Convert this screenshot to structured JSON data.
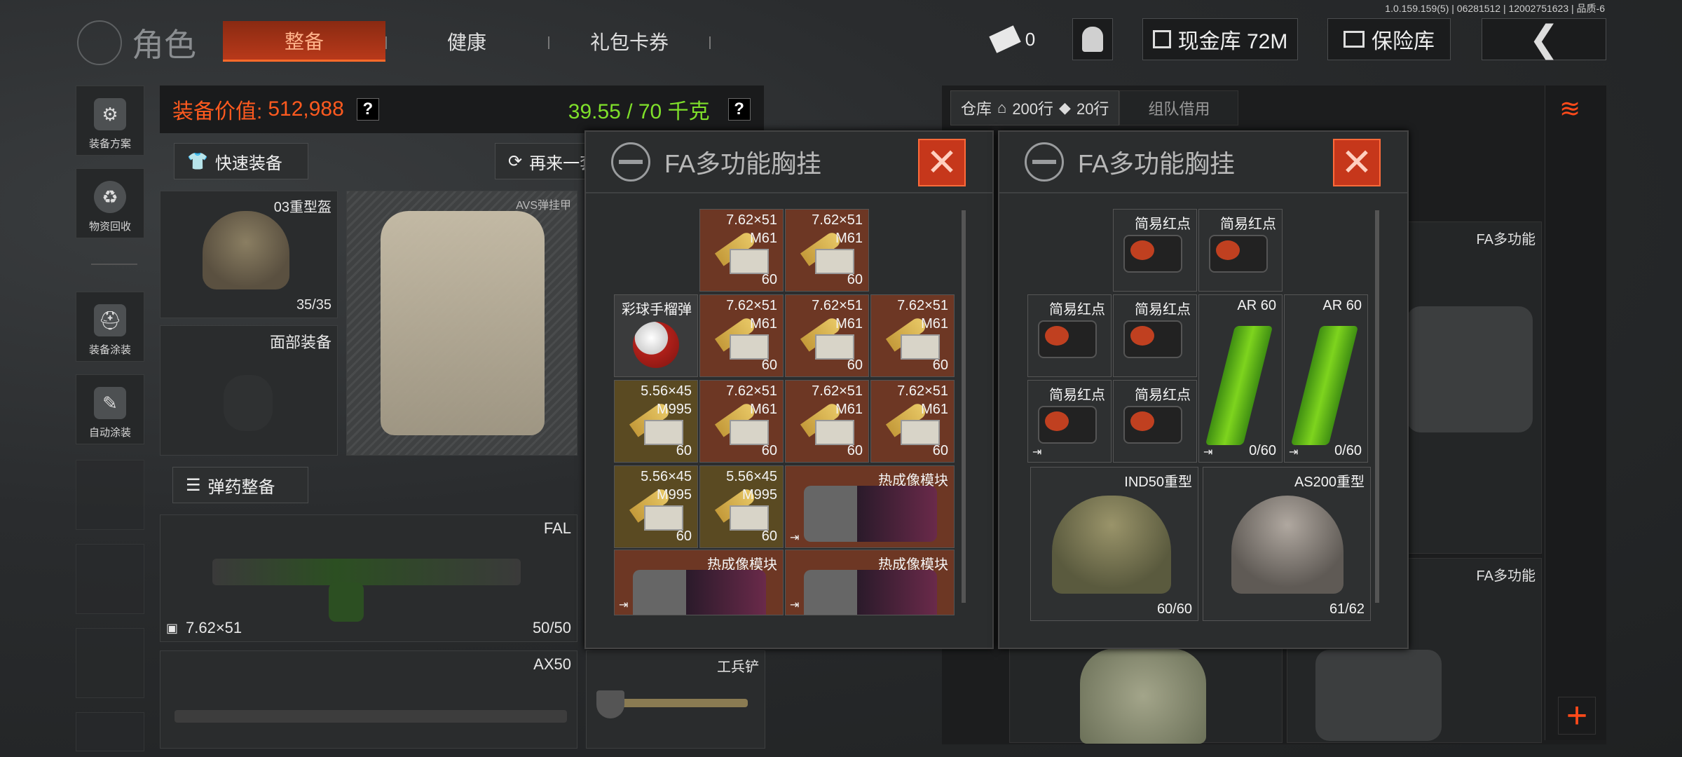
{
  "version": "1.0.159.159(5) | 06281512 | 12002751623 | 品质-6",
  "header": {
    "title": "角色",
    "tabs": [
      "整备",
      "健康",
      "礼包卡券"
    ],
    "tickets_count": "0",
    "cash_label": "现金库 72M",
    "vault_label": "保险库"
  },
  "sidebar": {
    "items": [
      "装备方案",
      "物资回收",
      "装备涂装",
      "自动涂装"
    ]
  },
  "equip": {
    "value_label": "装备价值:",
    "value": "512,988",
    "weight": "39.55 / 70 千克",
    "quick_equip": "快速装备",
    "again_btn": "再来一套",
    "ammo_btn": "弹药整备",
    "helmet_label": "03重型盔",
    "helmet_durability": "35/35",
    "armor_label": "AVS弹挂甲",
    "face_label": "面部装备",
    "weapon1_name": "FAL",
    "weapon1_caliber": "7.62×51",
    "weapon1_ammo": "50/50",
    "weapon2_name": "AX50",
    "melee_name": "工兵铲"
  },
  "pocket_left": {
    "title": "FA多功能胸挂",
    "cells": [
      {
        "t1": "7.62×51",
        "t2": "M61",
        "t3": "60",
        "kind": "amm"
      },
      {
        "t1": "7.62×51",
        "t2": "M61",
        "t3": "60",
        "kind": "amm"
      },
      {
        "t1": "彩球手榴弹",
        "t2": "",
        "t3": "",
        "kind": "grn"
      },
      {
        "t1": "7.62×51",
        "t2": "M61",
        "t3": "60",
        "kind": "amm"
      },
      {
        "t1": "7.62×51",
        "t2": "M61",
        "t3": "60",
        "kind": "amm"
      },
      {
        "t1": "7.62×51",
        "t2": "M61",
        "t3": "60",
        "kind": "amm"
      },
      {
        "t1": "5.56×45",
        "t2": "M995",
        "t3": "60",
        "kind": "amm2"
      },
      {
        "t1": "7.62×51",
        "t2": "M61",
        "t3": "60",
        "kind": "amm"
      },
      {
        "t1": "7.62×51",
        "t2": "M61",
        "t3": "60",
        "kind": "amm"
      },
      {
        "t1": "7.62×51",
        "t2": "M61",
        "t3": "60",
        "kind": "amm"
      },
      {
        "t1": "5.56×45",
        "t2": "M995",
        "t3": "60",
        "kind": "amm2"
      },
      {
        "t1": "5.56×45",
        "t2": "M995",
        "t3": "60",
        "kind": "amm2"
      }
    ],
    "thermal_label": "热成像模块"
  },
  "pocket_right": {
    "title": "FA多功能胸挂",
    "sight_label": "简易红点",
    "mag_label": "AR 60",
    "mag_count": "0/60",
    "helmet1_label": "IND50重型",
    "helmet1_count": "60/60",
    "helmet2_label": "AS200重型",
    "helmet2_count": "61/62"
  },
  "storage": {
    "warehouse_label": "仓库",
    "rows_label": "200行",
    "rows2_label": "20行",
    "team_borrow": "组队借用",
    "item_label": "FA多功能"
  },
  "colors": {
    "accent": "#ff6a2a",
    "value_orange": "#ff5a1f",
    "weight_green": "#7fe02a"
  }
}
